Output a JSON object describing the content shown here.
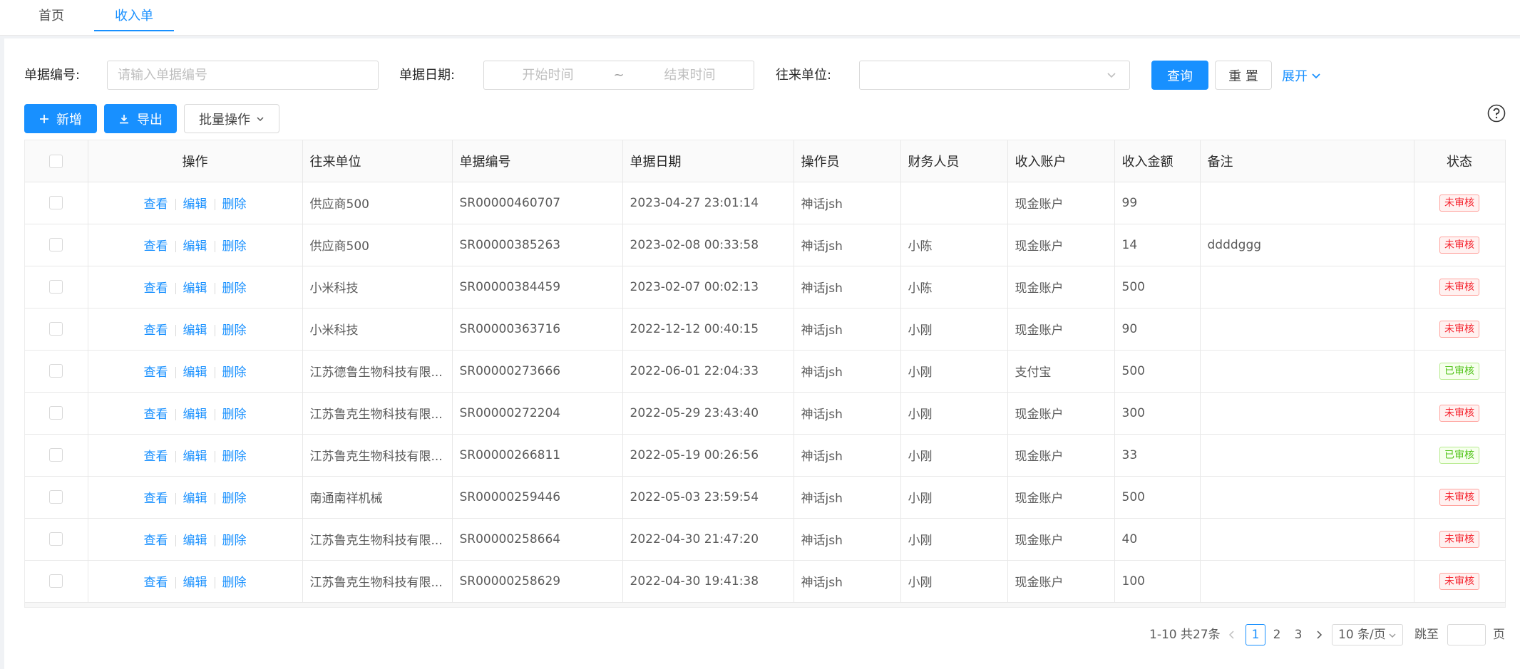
{
  "tabs": [
    {
      "label": "首页"
    },
    {
      "label": "收入单"
    }
  ],
  "search": {
    "bill_no_label": "单据编号:",
    "bill_no_placeholder": "请输入单据编号",
    "bill_date_label": "单据日期:",
    "start_placeholder": "开始时间",
    "range_sep": "~",
    "end_placeholder": "结束时间",
    "partner_label": "往来单位:",
    "query_label": "查询",
    "reset_label": "重 置",
    "expand_label": "展开"
  },
  "toolbar": {
    "add_label": "新增",
    "export_label": "导出",
    "batch_label": "批量操作"
  },
  "table": {
    "headers": {
      "ops": "操作",
      "partner": "往来单位",
      "bill_no": "单据编号",
      "date": "单据日期",
      "operator": "操作员",
      "finance": "财务人员",
      "account": "收入账户",
      "amount": "收入金额",
      "remark": "备注",
      "status": "状态"
    },
    "actions": {
      "view": "查看",
      "edit": "编辑",
      "delete": "删除"
    },
    "rows": [
      {
        "partner": "供应商500",
        "bill_no": "SR00000460707",
        "date": "2023-04-27 23:01:14",
        "operator": "神话jsh",
        "finance": "",
        "account": "现金账户",
        "amount": "99",
        "remark": "",
        "status": "未审核",
        "status_type": "pending"
      },
      {
        "partner": "供应商500",
        "bill_no": "SR00000385263",
        "date": "2023-02-08 00:33:58",
        "operator": "神话jsh",
        "finance": "小陈",
        "account": "现金账户",
        "amount": "14",
        "remark": "ddddggg",
        "status": "未审核",
        "status_type": "pending"
      },
      {
        "partner": "小米科技",
        "bill_no": "SR00000384459",
        "date": "2023-02-07 00:02:13",
        "operator": "神话jsh",
        "finance": "小陈",
        "account": "现金账户",
        "amount": "500",
        "remark": "",
        "status": "未审核",
        "status_type": "pending"
      },
      {
        "partner": "小米科技",
        "bill_no": "SR00000363716",
        "date": "2022-12-12 00:40:15",
        "operator": "神话jsh",
        "finance": "小刚",
        "account": "现金账户",
        "amount": "90",
        "remark": "",
        "status": "未审核",
        "status_type": "pending"
      },
      {
        "partner": "江苏德鲁生物科技有限...",
        "bill_no": "SR00000273666",
        "date": "2022-06-01 22:04:33",
        "operator": "神话jsh",
        "finance": "小刚",
        "account": "支付宝",
        "amount": "500",
        "remark": "",
        "status": "已审核",
        "status_type": "approved"
      },
      {
        "partner": "江苏鲁克生物科技有限...",
        "bill_no": "SR00000272204",
        "date": "2022-05-29 23:43:40",
        "operator": "神话jsh",
        "finance": "小刚",
        "account": "现金账户",
        "amount": "300",
        "remark": "",
        "status": "未审核",
        "status_type": "pending"
      },
      {
        "partner": "江苏鲁克生物科技有限...",
        "bill_no": "SR00000266811",
        "date": "2022-05-19 00:26:56",
        "operator": "神话jsh",
        "finance": "小刚",
        "account": "现金账户",
        "amount": "33",
        "remark": "",
        "status": "已审核",
        "status_type": "approved"
      },
      {
        "partner": "南通南祥机械",
        "bill_no": "SR00000259446",
        "date": "2022-05-03 23:59:54",
        "operator": "神话jsh",
        "finance": "小刚",
        "account": "现金账户",
        "amount": "500",
        "remark": "",
        "status": "未审核",
        "status_type": "pending"
      },
      {
        "partner": "江苏鲁克生物科技有限...",
        "bill_no": "SR00000258664",
        "date": "2022-04-30 21:47:20",
        "operator": "神话jsh",
        "finance": "小刚",
        "account": "现金账户",
        "amount": "40",
        "remark": "",
        "status": "未审核",
        "status_type": "pending"
      },
      {
        "partner": "江苏鲁克生物科技有限...",
        "bill_no": "SR00000258629",
        "date": "2022-04-30 19:41:38",
        "operator": "神话jsh",
        "finance": "小刚",
        "account": "现金账户",
        "amount": "100",
        "remark": "",
        "status": "未审核",
        "status_type": "pending"
      }
    ]
  },
  "pagination": {
    "total_text": "1-10 共27条",
    "pages": [
      "1",
      "2",
      "3"
    ],
    "current_page": "1",
    "page_size": "10 条/页",
    "jump_label": "跳至",
    "page_suffix": "页"
  },
  "colors": {
    "primary": "#1890ff",
    "pending": "#f5222d",
    "approved": "#52c41a"
  }
}
